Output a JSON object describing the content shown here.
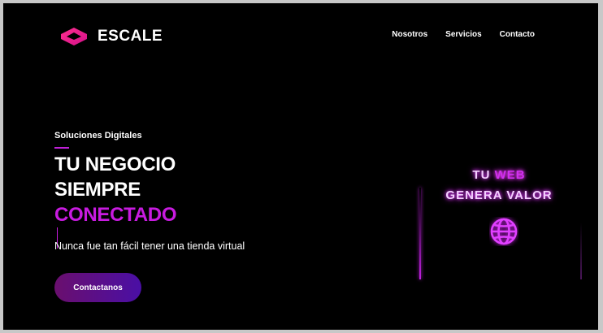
{
  "brand": {
    "name": "ESCALE",
    "accent": "#e8139a"
  },
  "nav": {
    "items": [
      "Nosotros",
      "Servicios",
      "Contacto"
    ]
  },
  "hero": {
    "eyebrow": "Soluciones Digitales",
    "line1": "TU NEGOCIO",
    "line2": "SIEMPRE",
    "line3": "CONECTADO",
    "tagline": "Nunca fue tan fácil tener una tienda virtual",
    "cta": "Contactanos",
    "accent_color": "#c81be0"
  },
  "neon_sign": {
    "line1_a": "TU",
    "line1_b": "WEB",
    "line2": "GENERA VALOR",
    "icon": "globe-icon"
  }
}
